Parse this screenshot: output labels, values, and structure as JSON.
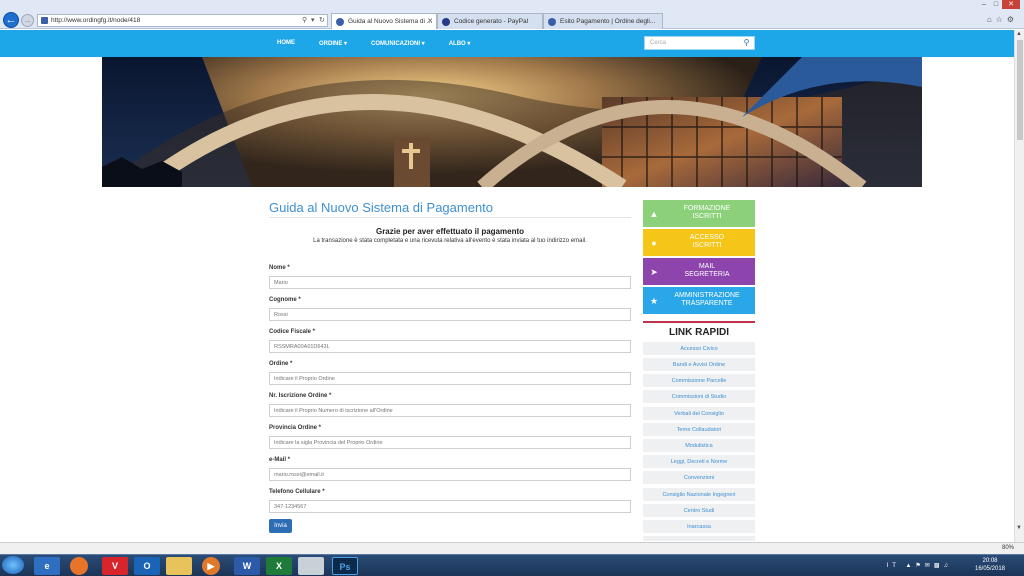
{
  "browser": {
    "url": "http://www.ordingfg.it/node/418",
    "tabs": [
      {
        "title": "Guida al Nuovo Sistema di ...",
        "active": true
      },
      {
        "title": "Codice generato - PayPal",
        "active": false
      },
      {
        "title": "Esito Pagamento | Ordine degli...",
        "active": false
      }
    ]
  },
  "nav": {
    "items": [
      "HOME",
      "ORDINE ▾",
      "COMUNICAZIONI ▾",
      "ALBO ▾"
    ],
    "search_placeholder": "Cerca"
  },
  "main": {
    "title": "Guida al Nuovo Sistema di Pagamento",
    "thanks_heading": "Grazie per aver effettuato il pagamento",
    "thanks_text": "La transazione è stata completata e una ricevuta relativa all'evento è stata inviata al tuo indirizzo email.",
    "fields": [
      {
        "label": "Nome *",
        "placeholder": "Mario"
      },
      {
        "label": "Cognome *",
        "placeholder": "Rossi"
      },
      {
        "label": "Codice Fiscale *",
        "placeholder": "RSSMRA00A01D643L"
      },
      {
        "label": "Ordine *",
        "placeholder": "Indicare il Proprio Ordine"
      },
      {
        "label": "Nr. Iscrizione Ordine *",
        "placeholder": "Indicare il Proprio Numero di iscrizione all'Ordine"
      },
      {
        "label": "Provincia Ordine *",
        "placeholder": "Indicare la sigla Provincia del Proprio Ordine"
      },
      {
        "label": "e-Mail *",
        "placeholder": "mario.rossi@email.it"
      },
      {
        "label": "Telefono Cellulare *",
        "placeholder": "347-1234567"
      }
    ],
    "submit_label": "Invia"
  },
  "sidebar": {
    "buttons": [
      {
        "line1": "FORMAZIONE",
        "line2": "ISCRITTI",
        "color": "#8cd17a",
        "icon": "graduation-cap-icon"
      },
      {
        "line1": "ACCESSO",
        "line2": "ISCRITTI",
        "color": "#f5c518",
        "icon": "user-icon"
      },
      {
        "line1": "MAIL",
        "line2": "SEGRETERIA",
        "color": "#8e44ad",
        "icon": "paper-plane-icon"
      },
      {
        "line1": "AMMINISTRAZIONE",
        "line2": "TRASPARENTE",
        "color": "#2aa7e8",
        "icon": "star-icon"
      }
    ],
    "link_rapidi_title": "LINK RAPIDI",
    "links": [
      "Accesso Civico",
      "Bandi e Avvisi Ordine",
      "Commissione Parcelle",
      "Commissioni di Studio",
      "Verbali del Consiglio",
      "Terne Collaudatori",
      "Modulistica",
      "Leggi, Decreti e Norme",
      "Convenzioni",
      "Consiglio Nazionale Ingegneri",
      "Centro Studi",
      "Inarcassa"
    ]
  },
  "status": {
    "zoom": "80%"
  },
  "taskbar": {
    "lang": "IT",
    "time": "20:08",
    "date": "16/05/2018"
  }
}
